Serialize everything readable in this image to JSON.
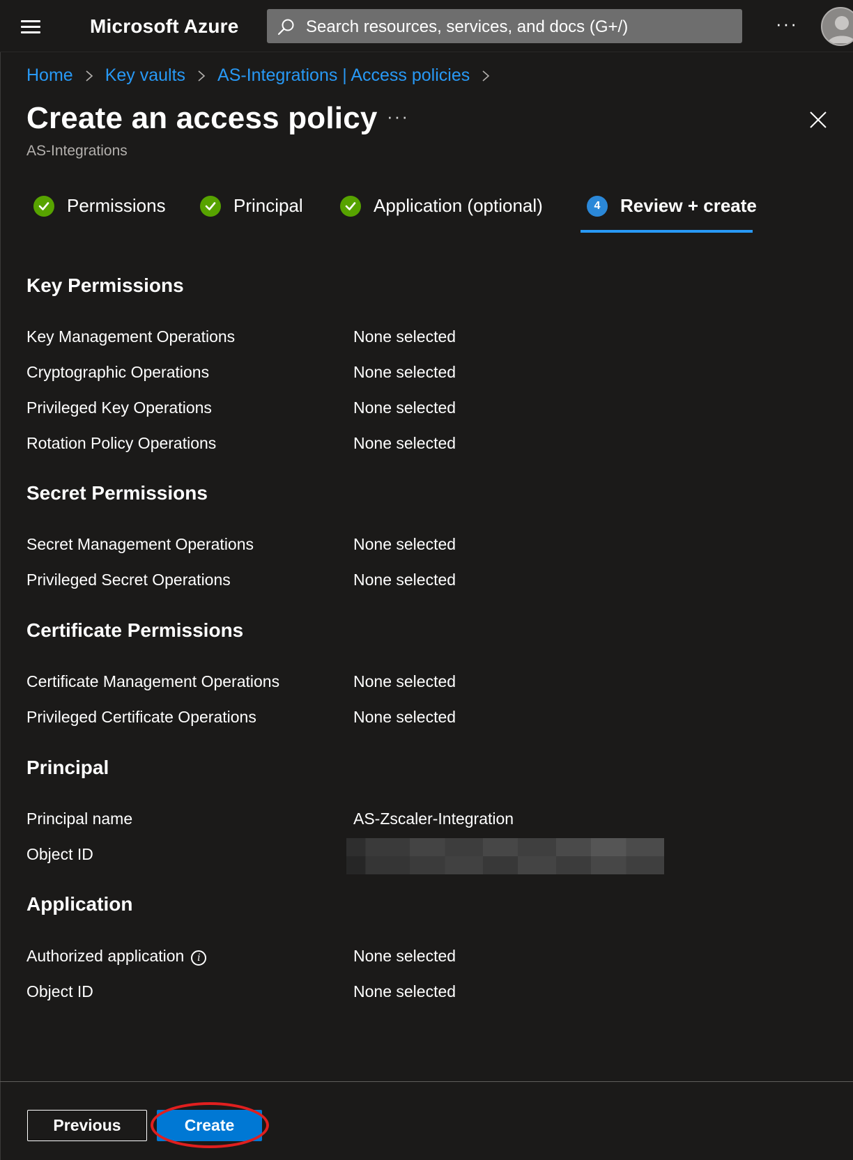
{
  "topbar": {
    "brand": "Microsoft Azure",
    "search_placeholder": "Search resources, services, and docs (G+/)",
    "more": "···"
  },
  "breadcrumb": {
    "items": [
      "Home",
      "Key vaults",
      "AS-Integrations | Access policies"
    ]
  },
  "header": {
    "title": "Create an access policy",
    "more": "···",
    "subtitle": "AS-Integrations"
  },
  "steps": [
    {
      "label": "Permissions",
      "state": "done"
    },
    {
      "label": "Principal",
      "state": "done"
    },
    {
      "label": "Application (optional)",
      "state": "done"
    },
    {
      "label": "Review + create",
      "state": "active",
      "number": "4"
    }
  ],
  "sections": {
    "key": {
      "heading": "Key Permissions",
      "rows": [
        {
          "label": "Key Management Operations",
          "value": "None selected"
        },
        {
          "label": "Cryptographic Operations",
          "value": "None selected"
        },
        {
          "label": "Privileged Key Operations",
          "value": "None selected"
        },
        {
          "label": "Rotation Policy Operations",
          "value": "None selected"
        }
      ]
    },
    "secret": {
      "heading": "Secret Permissions",
      "rows": [
        {
          "label": "Secret Management Operations",
          "value": "None selected"
        },
        {
          "label": "Privileged Secret Operations",
          "value": "None selected"
        }
      ]
    },
    "certificate": {
      "heading": "Certificate Permissions",
      "rows": [
        {
          "label": "Certificate Management Operations",
          "value": "None selected"
        },
        {
          "label": "Privileged Certificate Operations",
          "value": "None selected"
        }
      ]
    },
    "principal": {
      "heading": "Principal",
      "rows": [
        {
          "label": "Principal name",
          "value": "AS-Zscaler-Integration"
        },
        {
          "label": "Object ID",
          "value": ""
        }
      ]
    },
    "application": {
      "heading": "Application",
      "rows": [
        {
          "label": "Authorized application",
          "value": "None selected"
        },
        {
          "label": "Object ID",
          "value": "None selected"
        }
      ]
    }
  },
  "footer": {
    "previous_label": "Previous",
    "create_label": "Create"
  },
  "colors": {
    "background": "#1b1a19",
    "link": "#2899f5",
    "primary": "#0078d4",
    "success": "#57a300",
    "highlight": "#e01f1f"
  }
}
